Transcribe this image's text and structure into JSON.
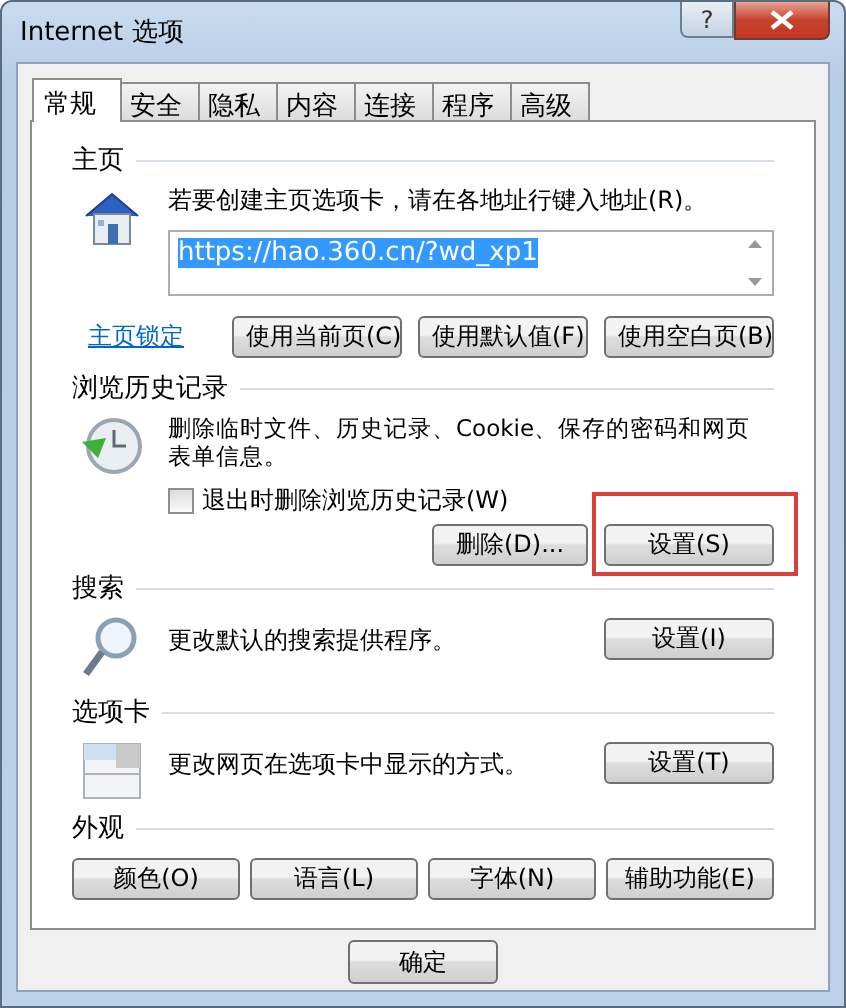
{
  "window": {
    "title": "Internet 选项",
    "help_label": "?"
  },
  "tabs": [
    {
      "label": "常规",
      "selected": true
    },
    {
      "label": "安全",
      "selected": false
    },
    {
      "label": "隐私",
      "selected": false
    },
    {
      "label": "内容",
      "selected": false
    },
    {
      "label": "连接",
      "selected": false
    },
    {
      "label": "程序",
      "selected": false
    },
    {
      "label": "高级",
      "selected": false
    }
  ],
  "home_page": {
    "heading": "主页",
    "description": "若要创建主页选项卡，请在各地址行键入地址(R)。",
    "url": "https://hao.360.cn/?wd_xp1",
    "url_selected": true,
    "lock_link": "主页锁定",
    "buttons": [
      "使用当前页(C)",
      "使用默认值(F)",
      "使用空白页(B)"
    ]
  },
  "browsing_history": {
    "heading": "浏览历史记录",
    "description": "删除临时文件、历史记录、Cookie、保存的密码和网页表单信息。",
    "checkbox": {
      "label": "退出时删除浏览历史记录(W)",
      "checked": false
    },
    "buttons": [
      {
        "label": "删除(D)...",
        "highlighted": false
      },
      {
        "label": "设置(S)",
        "highlighted": true
      }
    ]
  },
  "search": {
    "heading": "搜索",
    "description": "更改默认的搜索提供程序。",
    "button": "设置(I)"
  },
  "tabs_section": {
    "heading": "选项卡",
    "description": "更改网页在选项卡中显示的方式。",
    "button": "设置(T)"
  },
  "appearance": {
    "heading": "外观",
    "buttons": [
      "颜色(O)",
      "语言(L)",
      "字体(N)",
      "辅助功能(E)"
    ]
  },
  "footer_buttons": [
    "确定"
  ]
}
